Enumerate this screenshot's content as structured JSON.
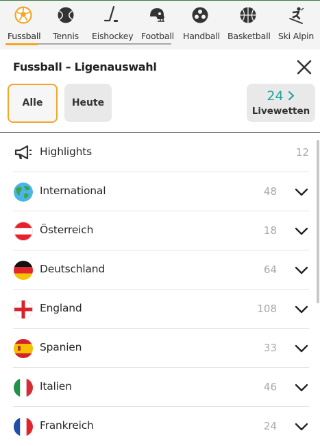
{
  "sports": [
    {
      "label": "Fussball",
      "icon": "soccer-ball-icon",
      "active": true
    },
    {
      "label": "Tennis",
      "icon": "tennis-ball-icon"
    },
    {
      "label": "Eishockey",
      "icon": "hockey-stick-icon"
    },
    {
      "label": "Football",
      "icon": "football-helmet-icon"
    },
    {
      "label": "Handball",
      "icon": "handball-icon"
    },
    {
      "label": "Basketball",
      "icon": "basketball-icon"
    },
    {
      "label": "Ski Alpin",
      "icon": "skier-icon"
    }
  ],
  "header": {
    "title": "Fussball – Ligenauswahl",
    "filter_all": "Alle",
    "filter_today": "Heute",
    "live_count": "24",
    "live_label": "Livewetten"
  },
  "leagues": [
    {
      "name": "Highlights",
      "count": "12",
      "icon": "megaphone-icon"
    },
    {
      "name": "International",
      "count": "48",
      "icon": "globe-icon"
    },
    {
      "name": "Österreich",
      "count": "18",
      "icon": "austria-flag-icon"
    },
    {
      "name": "Deutschland",
      "count": "64",
      "icon": "germany-flag-icon"
    },
    {
      "name": "England",
      "count": "108",
      "icon": "england-flag-icon"
    },
    {
      "name": "Spanien",
      "count": "33",
      "icon": "spain-flag-icon"
    },
    {
      "name": "Italien",
      "count": "46",
      "icon": "italy-flag-icon"
    },
    {
      "name": "Frankreich",
      "count": "24",
      "icon": "france-flag-icon"
    }
  ],
  "colors": {
    "accent": "#f5a623",
    "live": "#1ca39a",
    "count": "#a8a8a8"
  }
}
